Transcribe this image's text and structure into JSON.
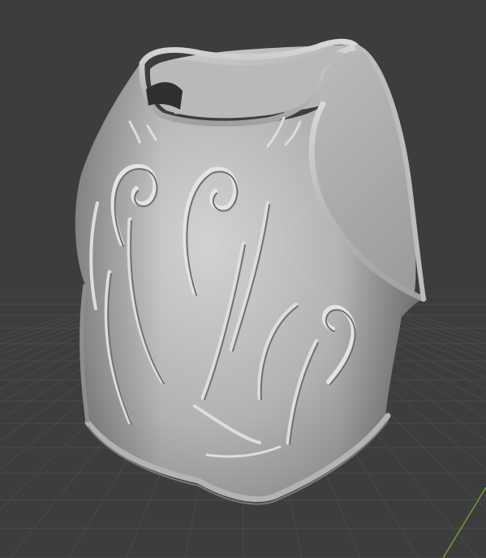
{
  "viewport": {
    "background_color": "#3d3d3d",
    "grid_line_color": "#4a4a4a",
    "y_axis_color": "#6b9a2e",
    "model_base_color": "#a8a8a8",
    "model_highlight_color": "#cfcfcf",
    "model_shadow_color": "#7c7c7c"
  }
}
